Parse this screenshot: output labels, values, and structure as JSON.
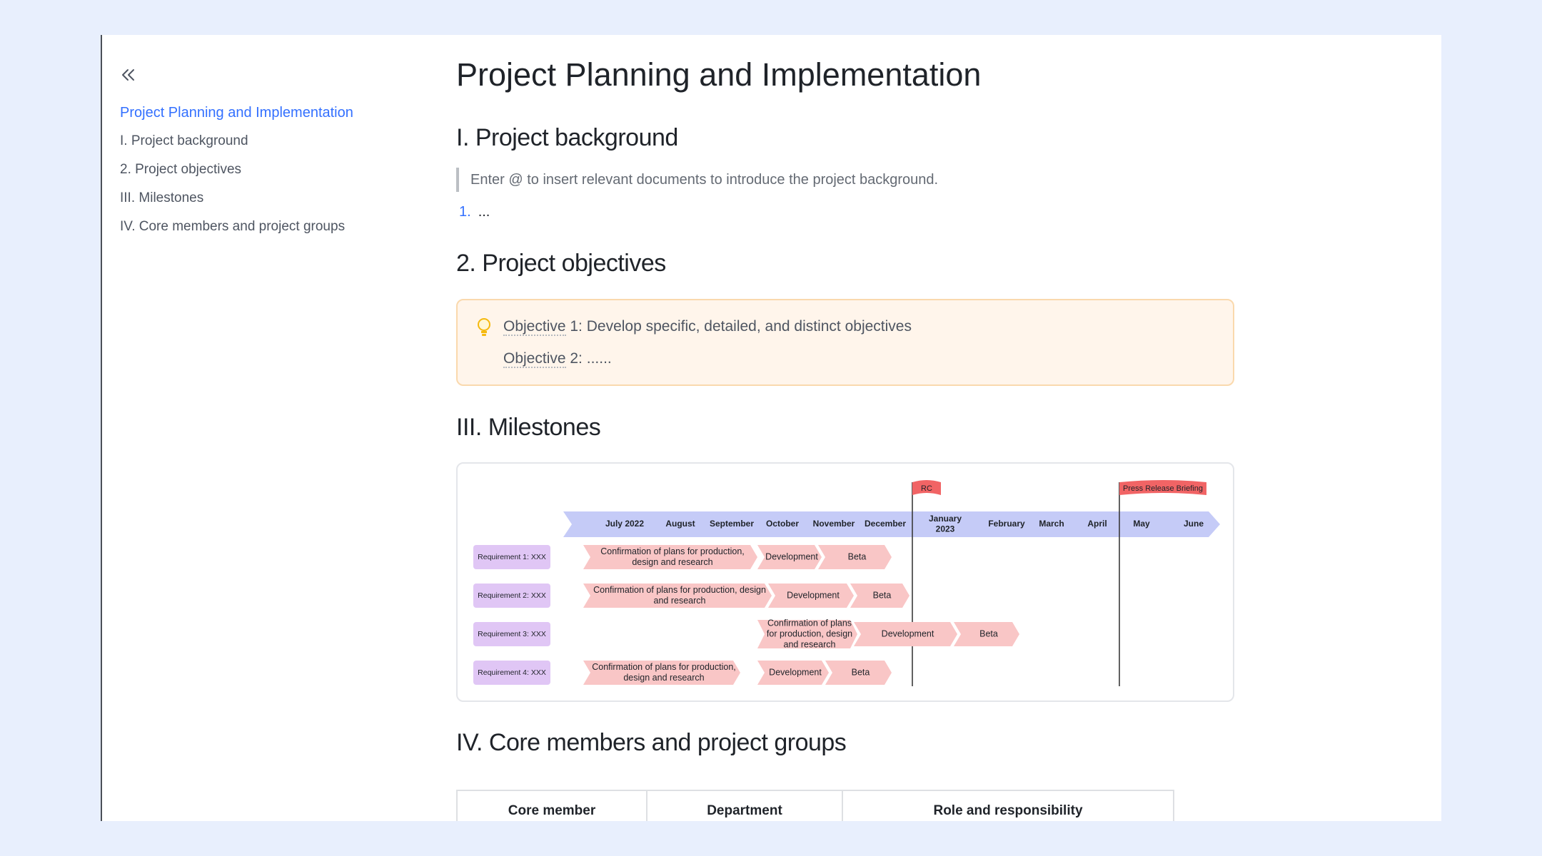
{
  "toc": {
    "items": [
      {
        "label": "Project Planning and Implementation",
        "active": true
      },
      {
        "label": "I. Project background"
      },
      {
        "label": "2. Project objectives"
      },
      {
        "label": "III. Milestones"
      },
      {
        "label": "IV. Core members and project groups"
      }
    ]
  },
  "doc": {
    "title": "Project Planning and Implementation",
    "sections": {
      "background": {
        "heading": "I. Project background",
        "quote": "Enter @ to insert relevant documents to introduce the project background.",
        "list_num": "1.",
        "list_text": "..."
      },
      "objectives": {
        "heading": "2. Project objectives",
        "obj1_word": "Objective",
        "obj1_rest": " 1: Develop specific, detailed, and distinct objectives",
        "obj2_word": "Objective",
        "obj2_rest": " 2: ......"
      },
      "milestones": {
        "heading": "III. Milestones"
      },
      "members": {
        "heading": "IV. Core members and project groups",
        "columns": [
          "Core member",
          "Department",
          "Role and responsibility"
        ]
      }
    }
  },
  "colors": {
    "accent": "#3370ff",
    "timeline": "#c5cbf7",
    "requirement": "#e0c6f5",
    "phase": "#f9c6c6",
    "flag": "#f16465",
    "callout_bg": "#fff5eb",
    "callout_border": "#fad9ad"
  },
  "chart_data": {
    "type": "gantt",
    "months": [
      "July 2022",
      "August",
      "September",
      "October",
      "November",
      "December",
      "January 2023",
      "February",
      "March",
      "April",
      "May",
      "June"
    ],
    "flags": [
      {
        "label": "RC",
        "at": "December"
      },
      {
        "label": "Press Release Briefing",
        "at": "April"
      }
    ],
    "requirements": [
      {
        "label": "Requirement 1: XXX",
        "phases": [
          {
            "label": "Confirmation of plans for production, design and research"
          },
          {
            "label": "Development"
          },
          {
            "label": "Beta"
          }
        ]
      },
      {
        "label": "Requirement 2: XXX",
        "phases": [
          {
            "label": "Confirmation of plans for production, design and research"
          },
          {
            "label": "Development"
          },
          {
            "label": "Beta"
          }
        ]
      },
      {
        "label": "Requirement 3: XXX",
        "phases": [
          {
            "label": "Confirmation of plans for production, design and research"
          },
          {
            "label": "Development"
          },
          {
            "label": "Beta"
          }
        ]
      },
      {
        "label": "Requirement 4: XXX",
        "phases": [
          {
            "label": "Confirmation of plans for production, design and research"
          },
          {
            "label": "Development"
          },
          {
            "label": "Beta"
          }
        ]
      }
    ]
  }
}
